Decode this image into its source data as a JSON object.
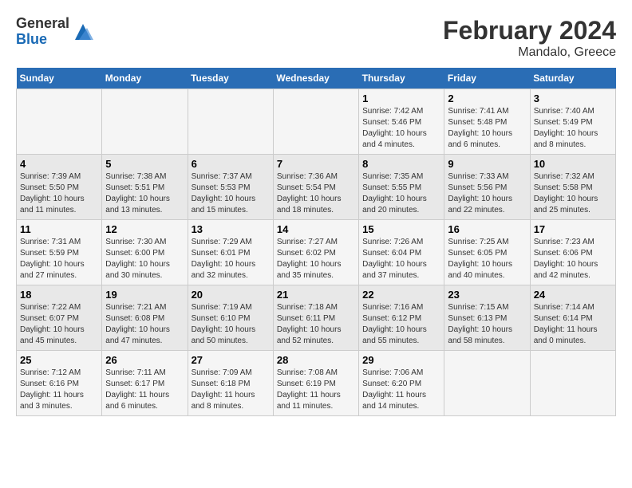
{
  "header": {
    "logo_general": "General",
    "logo_blue": "Blue",
    "title": "February 2024",
    "subtitle": "Mandalo, Greece"
  },
  "weekdays": [
    "Sunday",
    "Monday",
    "Tuesday",
    "Wednesday",
    "Thursday",
    "Friday",
    "Saturday"
  ],
  "weeks": [
    [
      {
        "day": "",
        "info": ""
      },
      {
        "day": "",
        "info": ""
      },
      {
        "day": "",
        "info": ""
      },
      {
        "day": "",
        "info": ""
      },
      {
        "day": "1",
        "info": "Sunrise: 7:42 AM\nSunset: 5:46 PM\nDaylight: 10 hours\nand 4 minutes."
      },
      {
        "day": "2",
        "info": "Sunrise: 7:41 AM\nSunset: 5:48 PM\nDaylight: 10 hours\nand 6 minutes."
      },
      {
        "day": "3",
        "info": "Sunrise: 7:40 AM\nSunset: 5:49 PM\nDaylight: 10 hours\nand 8 minutes."
      }
    ],
    [
      {
        "day": "4",
        "info": "Sunrise: 7:39 AM\nSunset: 5:50 PM\nDaylight: 10 hours\nand 11 minutes."
      },
      {
        "day": "5",
        "info": "Sunrise: 7:38 AM\nSunset: 5:51 PM\nDaylight: 10 hours\nand 13 minutes."
      },
      {
        "day": "6",
        "info": "Sunrise: 7:37 AM\nSunset: 5:53 PM\nDaylight: 10 hours\nand 15 minutes."
      },
      {
        "day": "7",
        "info": "Sunrise: 7:36 AM\nSunset: 5:54 PM\nDaylight: 10 hours\nand 18 minutes."
      },
      {
        "day": "8",
        "info": "Sunrise: 7:35 AM\nSunset: 5:55 PM\nDaylight: 10 hours\nand 20 minutes."
      },
      {
        "day": "9",
        "info": "Sunrise: 7:33 AM\nSunset: 5:56 PM\nDaylight: 10 hours\nand 22 minutes."
      },
      {
        "day": "10",
        "info": "Sunrise: 7:32 AM\nSunset: 5:58 PM\nDaylight: 10 hours\nand 25 minutes."
      }
    ],
    [
      {
        "day": "11",
        "info": "Sunrise: 7:31 AM\nSunset: 5:59 PM\nDaylight: 10 hours\nand 27 minutes."
      },
      {
        "day": "12",
        "info": "Sunrise: 7:30 AM\nSunset: 6:00 PM\nDaylight: 10 hours\nand 30 minutes."
      },
      {
        "day": "13",
        "info": "Sunrise: 7:29 AM\nSunset: 6:01 PM\nDaylight: 10 hours\nand 32 minutes."
      },
      {
        "day": "14",
        "info": "Sunrise: 7:27 AM\nSunset: 6:02 PM\nDaylight: 10 hours\nand 35 minutes."
      },
      {
        "day": "15",
        "info": "Sunrise: 7:26 AM\nSunset: 6:04 PM\nDaylight: 10 hours\nand 37 minutes."
      },
      {
        "day": "16",
        "info": "Sunrise: 7:25 AM\nSunset: 6:05 PM\nDaylight: 10 hours\nand 40 minutes."
      },
      {
        "day": "17",
        "info": "Sunrise: 7:23 AM\nSunset: 6:06 PM\nDaylight: 10 hours\nand 42 minutes."
      }
    ],
    [
      {
        "day": "18",
        "info": "Sunrise: 7:22 AM\nSunset: 6:07 PM\nDaylight: 10 hours\nand 45 minutes."
      },
      {
        "day": "19",
        "info": "Sunrise: 7:21 AM\nSunset: 6:08 PM\nDaylight: 10 hours\nand 47 minutes."
      },
      {
        "day": "20",
        "info": "Sunrise: 7:19 AM\nSunset: 6:10 PM\nDaylight: 10 hours\nand 50 minutes."
      },
      {
        "day": "21",
        "info": "Sunrise: 7:18 AM\nSunset: 6:11 PM\nDaylight: 10 hours\nand 52 minutes."
      },
      {
        "day": "22",
        "info": "Sunrise: 7:16 AM\nSunset: 6:12 PM\nDaylight: 10 hours\nand 55 minutes."
      },
      {
        "day": "23",
        "info": "Sunrise: 7:15 AM\nSunset: 6:13 PM\nDaylight: 10 hours\nand 58 minutes."
      },
      {
        "day": "24",
        "info": "Sunrise: 7:14 AM\nSunset: 6:14 PM\nDaylight: 11 hours\nand 0 minutes."
      }
    ],
    [
      {
        "day": "25",
        "info": "Sunrise: 7:12 AM\nSunset: 6:16 PM\nDaylight: 11 hours\nand 3 minutes."
      },
      {
        "day": "26",
        "info": "Sunrise: 7:11 AM\nSunset: 6:17 PM\nDaylight: 11 hours\nand 6 minutes."
      },
      {
        "day": "27",
        "info": "Sunrise: 7:09 AM\nSunset: 6:18 PM\nDaylight: 11 hours\nand 8 minutes."
      },
      {
        "day": "28",
        "info": "Sunrise: 7:08 AM\nSunset: 6:19 PM\nDaylight: 11 hours\nand 11 minutes."
      },
      {
        "day": "29",
        "info": "Sunrise: 7:06 AM\nSunset: 6:20 PM\nDaylight: 11 hours\nand 14 minutes."
      },
      {
        "day": "",
        "info": ""
      },
      {
        "day": "",
        "info": ""
      }
    ]
  ]
}
